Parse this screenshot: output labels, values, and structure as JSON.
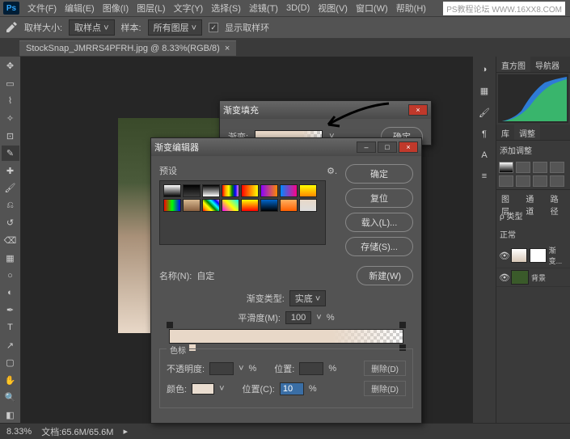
{
  "watermark": "PS教程论坛  WWW.16XX8.COM",
  "menu": [
    "文件(F)",
    "编辑(E)",
    "图像(I)",
    "图层(L)",
    "文字(Y)",
    "选择(S)",
    "滤镜(T)",
    "3D(D)",
    "视图(V)",
    "窗口(W)",
    "帮助(H)"
  ],
  "options": {
    "sample_size_label": "取样大小:",
    "sample_size_value": "取样点",
    "sample_label": "样本:",
    "sample_value": "所有图层",
    "show_ring": "显示取样环"
  },
  "document": {
    "tab": "StockSnap_JMRRS4PFRH.jpg @ 8.33%(RGB/8)",
    "close": "×"
  },
  "panels": {
    "histogram_tab": "直方图",
    "navigator_tab": "导航器",
    "lib_tab": "库",
    "adjust_tab": "调整",
    "add_adjust": "添加调整",
    "layers_tab": "图层",
    "channels_tab": "通道",
    "paths_tab": "路径",
    "kind_label": "ρ 类型",
    "blend_mode": "正常",
    "layer_grad": "渐变...",
    "layer_bg": "背景"
  },
  "status": {
    "zoom": "8.33%",
    "doc": "文档:65.6M/65.6M"
  },
  "gradient_fill": {
    "title": "渐变填充",
    "label": "渐变:",
    "ok": "确定"
  },
  "gradient_editor": {
    "title": "渐变编辑器",
    "presets_label": "预设",
    "ok": "确定",
    "reset": "复位",
    "load": "载入(L)...",
    "save": "存储(S)...",
    "name_label": "名称(N):",
    "name_value": "自定",
    "new_btn": "新建(W)",
    "type_label": "渐变类型:",
    "type_value": "实底",
    "smooth_label": "平滑度(M):",
    "smooth_value": "100",
    "percent": "%",
    "stops_label": "色标",
    "opacity_label": "不透明度:",
    "opacity_value": "",
    "pos_label": "位置:",
    "pos_value": "",
    "delete_d": "删除(D)",
    "color_label": "颜色:",
    "pos_c_label": "位置(C):",
    "pos_c_value": "10"
  }
}
